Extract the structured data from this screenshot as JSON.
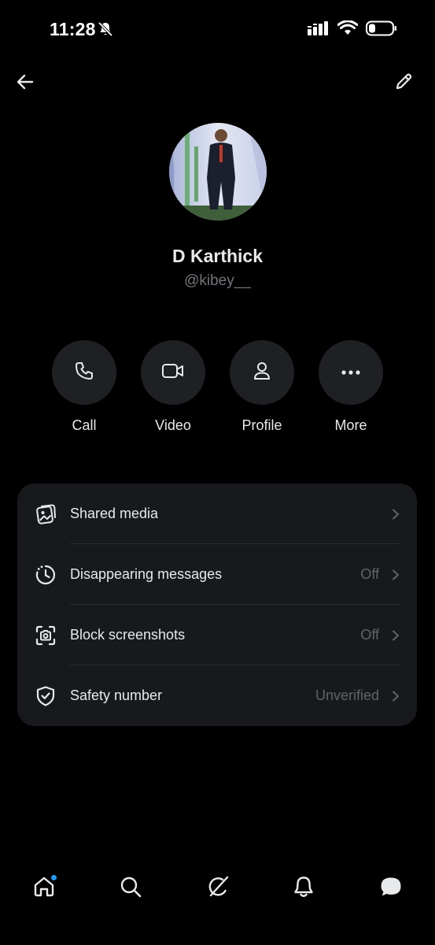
{
  "status_bar": {
    "time": "11:28",
    "icons": [
      "bell-off-icon",
      "signal-icon",
      "wifi-icon",
      "battery-icon"
    ]
  },
  "top_bar": {
    "icons": [
      "back-arrow-icon",
      "edit-pencil-icon"
    ]
  },
  "profile": {
    "name": "D Karthick",
    "handle": "@kibey__"
  },
  "actions": [
    {
      "label": "Call",
      "icon": "phone-icon"
    },
    {
      "label": "Video",
      "icon": "video-camera-icon"
    },
    {
      "label": "Profile",
      "icon": "person-icon"
    },
    {
      "label": "More",
      "icon": "more-dots-icon"
    }
  ],
  "settings": [
    {
      "title": "Shared media",
      "value": "",
      "icon": "shared-media-icon"
    },
    {
      "title": "Disappearing messages",
      "value": "Off",
      "icon": "timer-icon"
    },
    {
      "title": "Block screenshots",
      "value": "Off",
      "icon": "screenshot-camera-icon"
    },
    {
      "title": "Safety number",
      "value": "Unverified",
      "icon": "shield-check-icon"
    }
  ],
  "bottom_nav": {
    "items": [
      "home-icon",
      "search-icon",
      "grok-icon",
      "notifications-icon",
      "messages-icon"
    ],
    "badge_color": "#1d9bf0"
  },
  "colors": {
    "background": "#000000",
    "card": "#18191c",
    "circle": "#1f2023",
    "text_primary": "#e7e9ea",
    "text_secondary": "#71767b",
    "accent": "#1d9bf0"
  }
}
